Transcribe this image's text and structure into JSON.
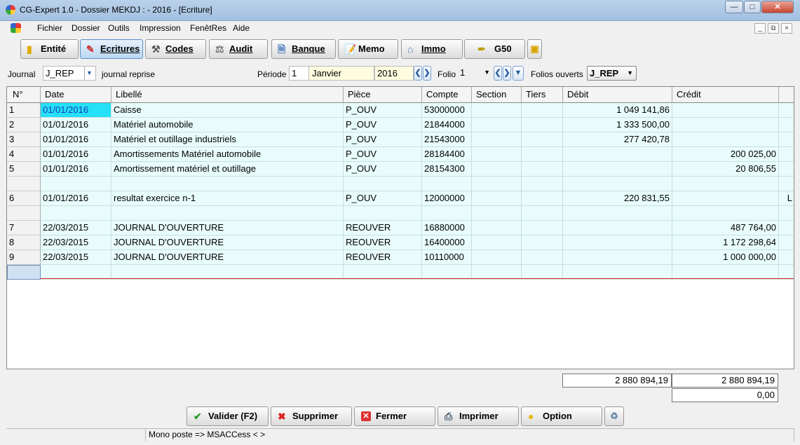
{
  "window": {
    "title": "CG-Expert 1.0 - Dossier MEKDJ :  - 2016 - [Ecriture]"
  },
  "menu": [
    "Fichier",
    "Dossier",
    "Outils",
    "Impression",
    "FenêtRes",
    "Aide"
  ],
  "toolbar": {
    "buttons": [
      {
        "label": "Entité",
        "icon": "folder-icon"
      },
      {
        "label": "Ecritures",
        "icon": "pencil-icon"
      },
      {
        "label": "Codes",
        "icon": "tools-icon"
      },
      {
        "label": "Audit",
        "icon": "scales-icon"
      },
      {
        "label": "Banque",
        "icon": "document-icon"
      },
      {
        "label": "Memo",
        "icon": "notepad-icon"
      },
      {
        "label": "Immo",
        "icon": "house-icon"
      },
      {
        "label": "G50",
        "icon": "pen-icon"
      }
    ]
  },
  "header": {
    "journal_label": "Journal",
    "journal_code": "J_REP",
    "journal_name": "journal reprise",
    "periode_label": "Période",
    "periode_num": "1",
    "periode_month": "Janvier",
    "periode_year": "2016",
    "folio_label": "Folio",
    "folio_value": "1",
    "folios_label": "Folios ouverts",
    "folios_value": "J_REP"
  },
  "grid": {
    "columns": [
      "N°",
      "Date",
      "Libellé",
      "Pièce",
      "Compte",
      "Section",
      "Tiers",
      "Débit",
      "Crédit"
    ],
    "rows": [
      {
        "n": "1",
        "date": "01/01/2016",
        "libelle": "Caisse",
        "piece": "P_OUV",
        "compte": "53000000",
        "section": "",
        "tiers": "",
        "debit": "1 049 141,86",
        "credit": "",
        "extra": ""
      },
      {
        "n": "2",
        "date": "01/01/2016",
        "libelle": "Matériel automobile",
        "piece": "P_OUV",
        "compte": "21844000",
        "section": "",
        "tiers": "",
        "debit": "1 333 500,00",
        "credit": "",
        "extra": ""
      },
      {
        "n": "3",
        "date": "01/01/2016",
        "libelle": "Matériel et outillage industriels",
        "piece": "P_OUV",
        "compte": "21543000",
        "section": "",
        "tiers": "",
        "debit": "277 420,78",
        "credit": "",
        "extra": ""
      },
      {
        "n": "4",
        "date": "01/01/2016",
        "libelle": "Amortissements Matériel automobile",
        "piece": "P_OUV",
        "compte": "28184400",
        "section": "",
        "tiers": "",
        "debit": "",
        "credit": "200 025,00",
        "extra": ""
      },
      {
        "n": "5",
        "date": "01/01/2016",
        "libelle": "Amortissement matériel et outillage",
        "piece": "P_OUV",
        "compte": "28154300",
        "section": "",
        "tiers": "",
        "debit": "",
        "credit": "20 806,55",
        "extra": ""
      },
      {
        "n": "",
        "date": "",
        "libelle": "",
        "piece": "",
        "compte": "",
        "section": "",
        "tiers": "",
        "debit": "",
        "credit": "",
        "extra": ""
      },
      {
        "n": "6",
        "date": "01/01/2016",
        "libelle": "resultat exercice n-1",
        "piece": "P_OUV",
        "compte": "12000000",
        "section": "",
        "tiers": "",
        "debit": "220 831,55",
        "credit": "",
        "extra": "L"
      },
      {
        "n": "",
        "date": "",
        "libelle": "",
        "piece": "",
        "compte": "",
        "section": "",
        "tiers": "",
        "debit": "",
        "credit": "",
        "extra": ""
      },
      {
        "n": "7",
        "date": "22/03/2015",
        "libelle": "JOURNAL D'OUVERTURE",
        "piece": "REOUVER",
        "compte": "16880000",
        "section": "",
        "tiers": "",
        "debit": "",
        "credit": "487 764,00",
        "extra": ""
      },
      {
        "n": "8",
        "date": "22/03/2015",
        "libelle": "JOURNAL D'OUVERTURE",
        "piece": "REOUVER",
        "compte": "16400000",
        "section": "",
        "tiers": "",
        "debit": "",
        "credit": "1 172 298,64",
        "extra": ""
      },
      {
        "n": "9",
        "date": "22/03/2015",
        "libelle": "JOURNAL D'OUVERTURE",
        "piece": "REOUVER",
        "compte": "10110000",
        "section": "",
        "tiers": "",
        "debit": "",
        "credit": "1 000 000,00",
        "extra": ""
      },
      {
        "n": "",
        "date": "",
        "libelle": "",
        "piece": "",
        "compte": "",
        "section": "",
        "tiers": "",
        "debit": "",
        "credit": "",
        "extra": ""
      }
    ]
  },
  "totals": {
    "debit": "2 880 894,19",
    "credit": "2 880 894,19",
    "solde": "0,00"
  },
  "bottom": {
    "valider": "Valider (F2)",
    "supprimer": "Supprimer",
    "fermer": "Fermer",
    "imprimer": "Imprimer",
    "option": "Option"
  },
  "status": {
    "mode": "Mono poste => MSACCess <  >"
  },
  "colors": {
    "row_bg": "#e8fcfc",
    "selected_cell": "#25e0f6",
    "red_line": "#d22222"
  }
}
